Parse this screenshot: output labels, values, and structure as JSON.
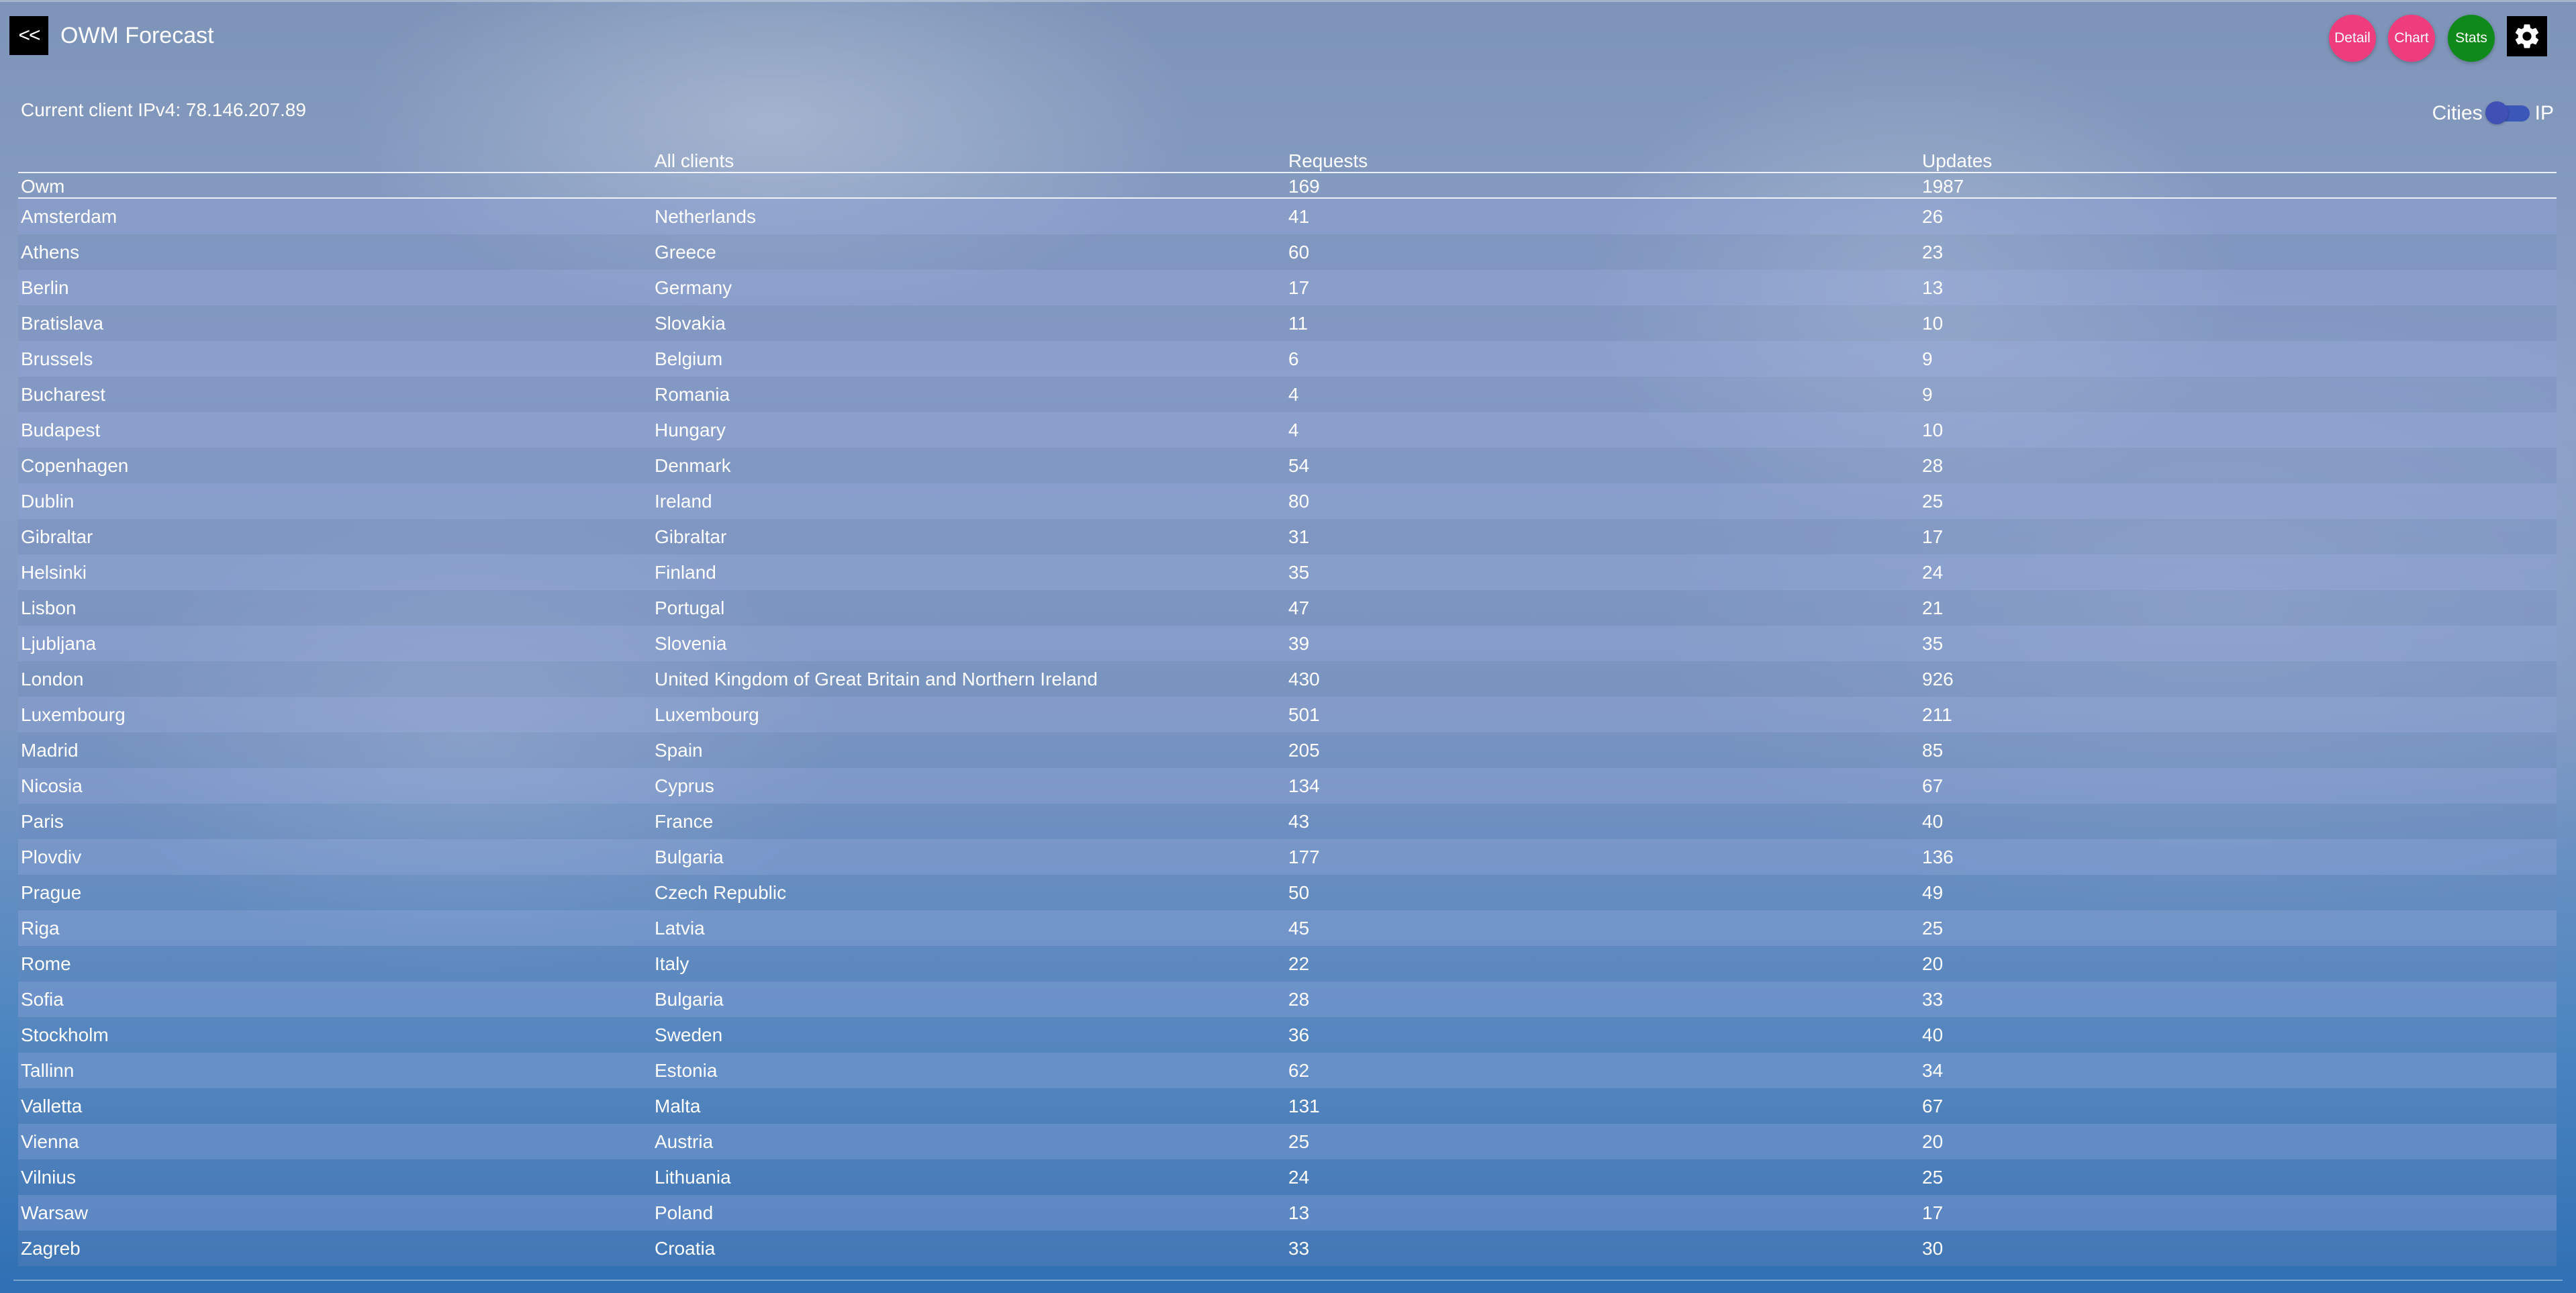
{
  "app": {
    "back_label": "<<",
    "title": "OWM Forecast"
  },
  "toolbar": {
    "detail_label": "Detail",
    "chart_label": "Chart",
    "stats_label": "Stats",
    "settings_icon": "gear-icon"
  },
  "client": {
    "ip_text": "Current client IPv4: 78.146.207.89"
  },
  "toggle": {
    "left_label": "Cities",
    "right_label": "IP",
    "state": "off"
  },
  "table": {
    "headers": [
      "",
      "All clients",
      "Requests",
      "Updates"
    ],
    "summary": {
      "name": "Owm",
      "country": "",
      "requests": "169",
      "updates": "1987"
    },
    "rows": [
      {
        "city": "Amsterdam",
        "country": "Netherlands",
        "requests": "41",
        "updates": "26"
      },
      {
        "city": "Athens",
        "country": "Greece",
        "requests": "60",
        "updates": "23"
      },
      {
        "city": "Berlin",
        "country": "Germany",
        "requests": "17",
        "updates": "13"
      },
      {
        "city": "Bratislava",
        "country": "Slovakia",
        "requests": "11",
        "updates": "10"
      },
      {
        "city": "Brussels",
        "country": "Belgium",
        "requests": "6",
        "updates": "9"
      },
      {
        "city": "Bucharest",
        "country": "Romania",
        "requests": "4",
        "updates": "9"
      },
      {
        "city": "Budapest",
        "country": "Hungary",
        "requests": "4",
        "updates": "10"
      },
      {
        "city": "Copenhagen",
        "country": "Denmark",
        "requests": "54",
        "updates": "28"
      },
      {
        "city": "Dublin",
        "country": "Ireland",
        "requests": "80",
        "updates": "25"
      },
      {
        "city": "Gibraltar",
        "country": "Gibraltar",
        "requests": "31",
        "updates": "17"
      },
      {
        "city": "Helsinki",
        "country": "Finland",
        "requests": "35",
        "updates": "24"
      },
      {
        "city": "Lisbon",
        "country": "Portugal",
        "requests": "47",
        "updates": "21"
      },
      {
        "city": "Ljubljana",
        "country": "Slovenia",
        "requests": "39",
        "updates": "35"
      },
      {
        "city": "London",
        "country": "United Kingdom of Great Britain and Northern Ireland",
        "requests": "430",
        "updates": "926"
      },
      {
        "city": "Luxembourg",
        "country": "Luxembourg",
        "requests": "501",
        "updates": "211"
      },
      {
        "city": "Madrid",
        "country": "Spain",
        "requests": "205",
        "updates": "85"
      },
      {
        "city": "Nicosia",
        "country": "Cyprus",
        "requests": "134",
        "updates": "67"
      },
      {
        "city": "Paris",
        "country": "France",
        "requests": "43",
        "updates": "40"
      },
      {
        "city": "Plovdiv",
        "country": "Bulgaria",
        "requests": "177",
        "updates": "136"
      },
      {
        "city": "Prague",
        "country": "Czech Republic",
        "requests": "50",
        "updates": "49"
      },
      {
        "city": "Riga",
        "country": "Latvia",
        "requests": "45",
        "updates": "25"
      },
      {
        "city": "Rome",
        "country": "Italy",
        "requests": "22",
        "updates": "20"
      },
      {
        "city": "Sofia",
        "country": "Bulgaria",
        "requests": "28",
        "updates": "33"
      },
      {
        "city": "Stockholm",
        "country": "Sweden",
        "requests": "36",
        "updates": "40"
      },
      {
        "city": "Tallinn",
        "country": "Estonia",
        "requests": "62",
        "updates": "34"
      },
      {
        "city": "Valletta",
        "country": "Malta",
        "requests": "131",
        "updates": "67"
      },
      {
        "city": "Vienna",
        "country": "Austria",
        "requests": "25",
        "updates": "20"
      },
      {
        "city": "Vilnius",
        "country": "Lithuania",
        "requests": "24",
        "updates": "25"
      },
      {
        "city": "Warsaw",
        "country": "Poland",
        "requests": "13",
        "updates": "17"
      },
      {
        "city": "Zagreb",
        "country": "Croatia",
        "requests": "33",
        "updates": "30"
      }
    ]
  },
  "colors": {
    "detail_button": "#ee3c7c",
    "chart_button": "#ee3c7c",
    "stats_button": "#0f8a1a",
    "toggle": "#3f51b5"
  }
}
